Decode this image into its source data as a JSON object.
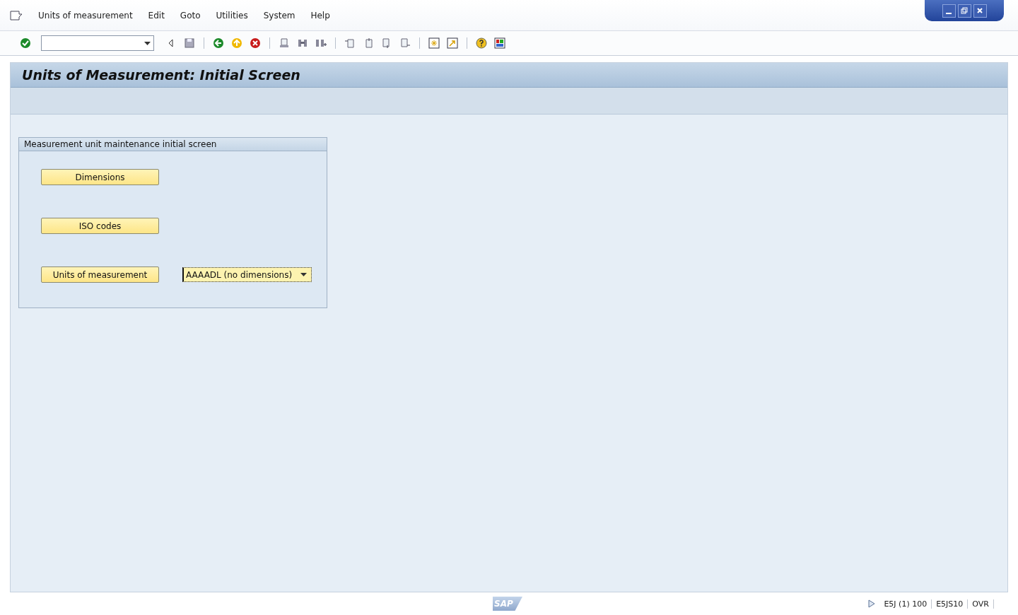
{
  "menu_bar": {
    "items": [
      {
        "label": "Units of measurement"
      },
      {
        "label": "Edit"
      },
      {
        "label": "Goto"
      },
      {
        "label": "Utilities"
      },
      {
        "label": "System"
      },
      {
        "label": "Help"
      }
    ]
  },
  "screen": {
    "title": "Units of Measurement: Initial Screen"
  },
  "group_box": {
    "title": "Measurement unit maintenance initial screen",
    "buttons": [
      {
        "label": "Dimensions"
      },
      {
        "label": "ISO codes"
      },
      {
        "label": "Units of measurement"
      }
    ],
    "unit_dropdown": {
      "value": "AAAADL (no dimensions)"
    }
  },
  "status_bar": {
    "logo": "SAP",
    "system": "E5J (1) 100",
    "server": "E5JS10",
    "mode": "OVR"
  }
}
